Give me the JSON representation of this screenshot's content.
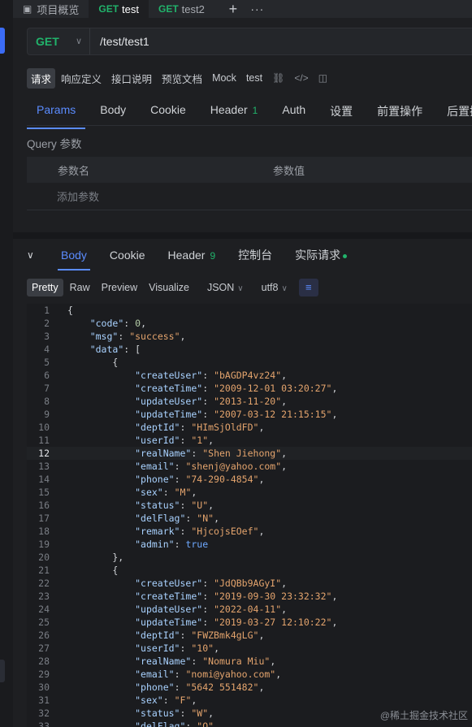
{
  "tabs": [
    {
      "method": "",
      "label": "项目概览",
      "active": false
    },
    {
      "method": "GET",
      "label": "test",
      "active": true
    },
    {
      "method": "GET",
      "label": "test2",
      "active": false
    }
  ],
  "request": {
    "method": "GET",
    "url": "/test/test1"
  },
  "subtoolbar": [
    "请求",
    "响应定义",
    "接口说明",
    "预览文档",
    "Mock",
    "test"
  ],
  "request_tabs": [
    {
      "label": "Params",
      "badge": ""
    },
    {
      "label": "Body",
      "badge": ""
    },
    {
      "label": "Cookie",
      "badge": ""
    },
    {
      "label": "Header",
      "badge": "1"
    },
    {
      "label": "Auth",
      "badge": ""
    },
    {
      "label": "设置",
      "badge": ""
    },
    {
      "label": "前置操作",
      "badge": ""
    },
    {
      "label": "后置操",
      "badge": ""
    }
  ],
  "query": {
    "label": "Query 参数",
    "col_name": "参数名",
    "col_value": "参数值",
    "add_label": "添加参数"
  },
  "response_tabs": [
    {
      "label": "Body",
      "badge": ""
    },
    {
      "label": "Cookie",
      "badge": ""
    },
    {
      "label": "Header",
      "badge": "9"
    },
    {
      "label": "控制台",
      "badge": ""
    },
    {
      "label": "实际请求",
      "badge": ""
    }
  ],
  "format": {
    "modes": [
      "Pretty",
      "Raw",
      "Preview",
      "Visualize"
    ],
    "type": "JSON",
    "encoding": "utf8"
  },
  "editor": {
    "current_line": 12,
    "lines": [
      "{",
      "    \"code\": 0,",
      "    \"msg\": \"success\",",
      "    \"data\": [",
      "        {",
      "            \"createUser\": \"bAGDP4vz24\",",
      "            \"createTime\": \"2009-12-01 03:20:27\",",
      "            \"updateUser\": \"2013-11-20\",",
      "            \"updateTime\": \"2007-03-12 21:15:15\",",
      "            \"deptId\": \"HImSjOldFD\",",
      "            \"userId\": \"1\",",
      "            \"realName\": \"Shen Jiehong\",",
      "            \"email\": \"shenj@yahoo.com\",",
      "            \"phone\": \"74-290-4854\",",
      "            \"sex\": \"M\",",
      "            \"status\": \"U\",",
      "            \"delFlag\": \"N\",",
      "            \"remark\": \"HjcojsEOef\",",
      "            \"admin\": true",
      "        },",
      "        {",
      "            \"createUser\": \"JdQBb9AGyI\",",
      "            \"createTime\": \"2019-09-30 23:32:32\",",
      "            \"updateUser\": \"2022-04-11\",",
      "            \"updateTime\": \"2019-03-27 12:10:22\",",
      "            \"deptId\": \"FWZBmk4gLG\",",
      "            \"userId\": \"10\",",
      "            \"realName\": \"Nomura Miu\",",
      "            \"email\": \"nomi@yahoo.com\",",
      "            \"phone\": \"5642 551482\",",
      "            \"sex\": \"F\",",
      "            \"status\": \"W\",",
      "            \"delFlag\": \"O\","
    ]
  },
  "watermark": "@稀土掘金技术社区"
}
